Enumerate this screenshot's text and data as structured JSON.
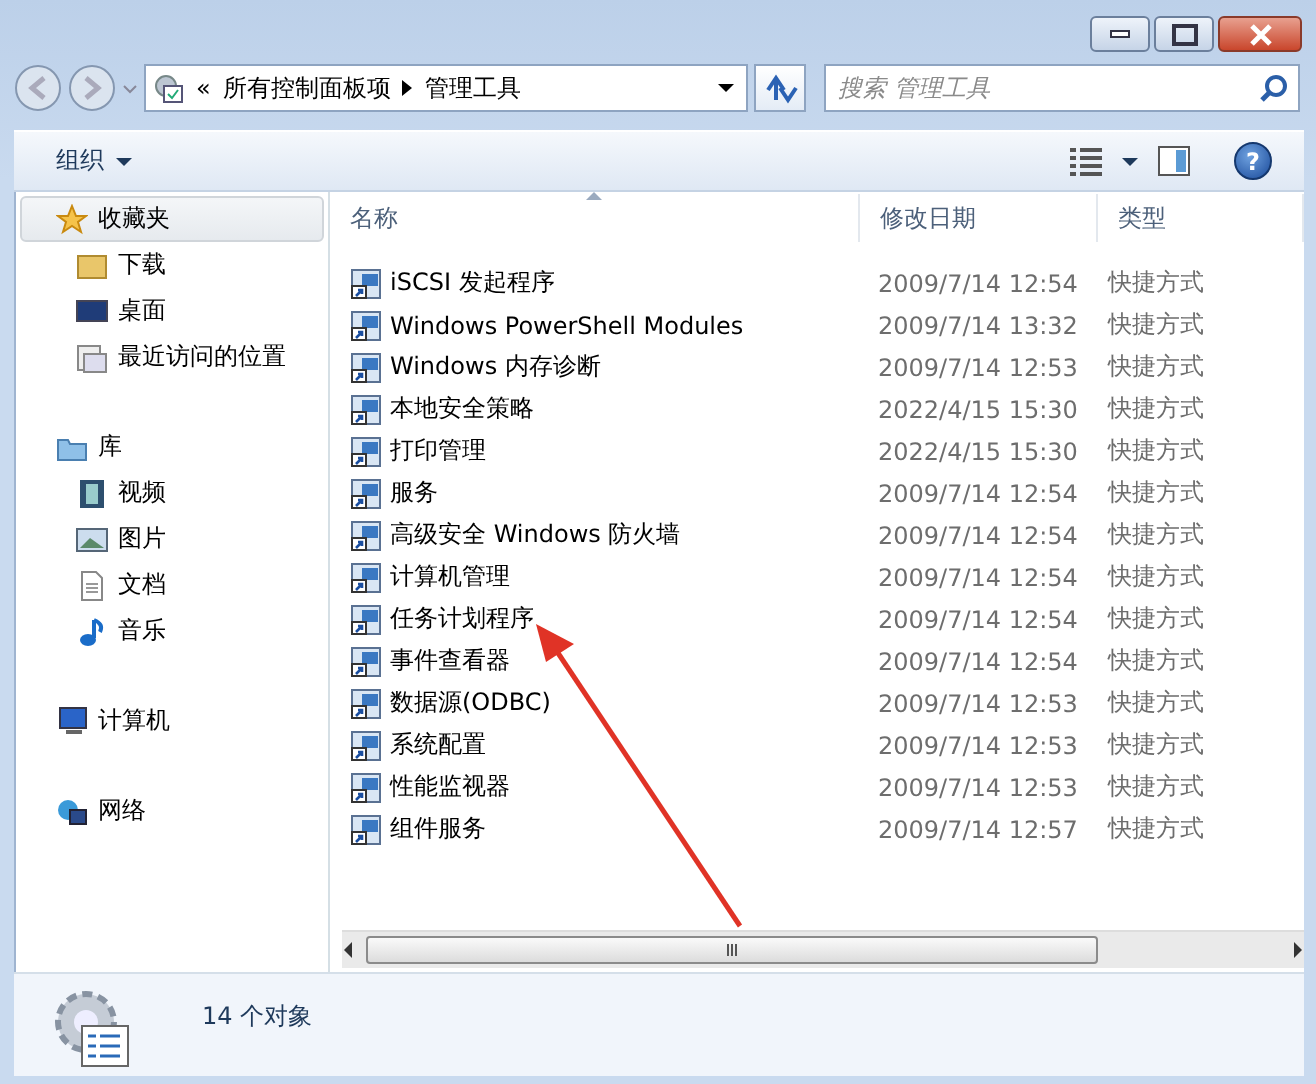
{
  "address_bar": {
    "overflow": "«",
    "crumbs": [
      "所有控制面板项",
      "管理工具"
    ]
  },
  "search": {
    "placeholder": "搜索 管理工具"
  },
  "toolbar": {
    "organize": "组织",
    "help": "?"
  },
  "sidebar": {
    "groups": [
      {
        "label": "收藏夹",
        "selected": true,
        "children": [
          {
            "label": "下载",
            "selected": false
          },
          {
            "label": "桌面",
            "selected": false
          },
          {
            "label": "最近访问的位置",
            "selected": false
          }
        ]
      },
      {
        "label": "库",
        "selected": false,
        "children": [
          {
            "label": "视频",
            "selected": false
          },
          {
            "label": "图片",
            "selected": false
          },
          {
            "label": "文档",
            "selected": false
          },
          {
            "label": "音乐",
            "selected": false
          }
        ]
      },
      {
        "label": "计算机",
        "selected": false
      },
      {
        "label": "网络",
        "selected": false
      }
    ]
  },
  "table": {
    "columns": [
      {
        "label": "名称",
        "sorted": true
      },
      {
        "label": "修改日期",
        "sorted": false
      },
      {
        "label": "类型",
        "sorted": false
      }
    ],
    "rows": [
      {
        "name": "iSCSI 发起程序",
        "date": "2009/7/14 12:54",
        "type": "快捷方式"
      },
      {
        "name": "Windows PowerShell Modules",
        "date": "2009/7/14 13:32",
        "type": "快捷方式"
      },
      {
        "name": "Windows 内存诊断",
        "date": "2009/7/14 12:53",
        "type": "快捷方式"
      },
      {
        "name": "本地安全策略",
        "date": "2022/4/15 15:30",
        "type": "快捷方式"
      },
      {
        "name": "打印管理",
        "date": "2022/4/15 15:30",
        "type": "快捷方式"
      },
      {
        "name": "服务",
        "date": "2009/7/14 12:54",
        "type": "快捷方式"
      },
      {
        "name": "高级安全 Windows 防火墙",
        "date": "2009/7/14 12:54",
        "type": "快捷方式"
      },
      {
        "name": "计算机管理",
        "date": "2009/7/14 12:54",
        "type": "快捷方式"
      },
      {
        "name": "任务计划程序",
        "date": "2009/7/14 12:54",
        "type": "快捷方式"
      },
      {
        "name": "事件查看器",
        "date": "2009/7/14 12:54",
        "type": "快捷方式"
      },
      {
        "name": "数据源(ODBC)",
        "date": "2009/7/14 12:53",
        "type": "快捷方式"
      },
      {
        "name": "系统配置",
        "date": "2009/7/14 12:53",
        "type": "快捷方式"
      },
      {
        "name": "性能监视器",
        "date": "2009/7/14 12:53",
        "type": "快捷方式"
      },
      {
        "name": "组件服务",
        "date": "2009/7/14 12:57",
        "type": "快捷方式"
      }
    ]
  },
  "status_bar": {
    "text": "14 个对象"
  }
}
